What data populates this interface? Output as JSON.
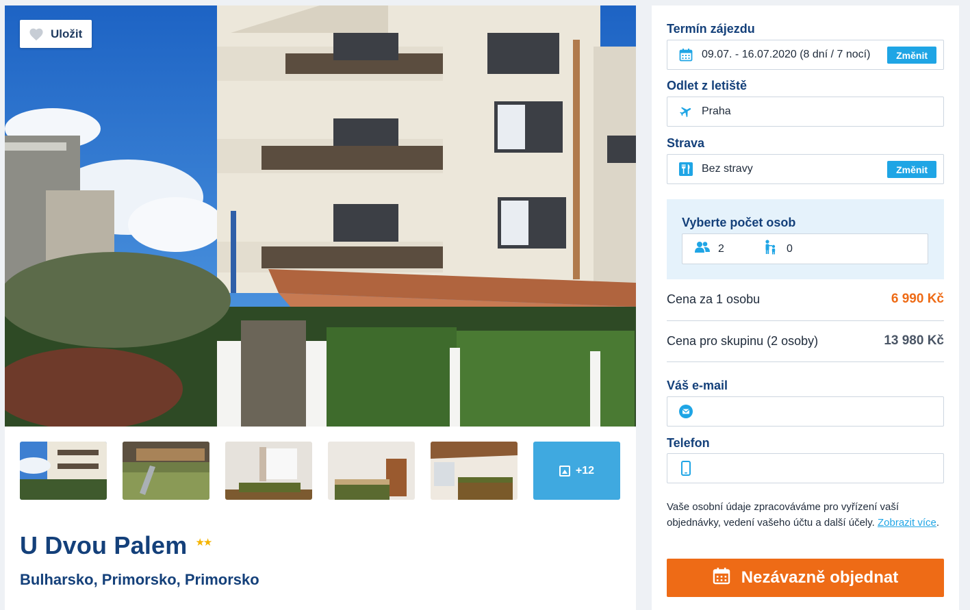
{
  "gallery": {
    "save_label": "Uložit",
    "more_count": "+12"
  },
  "hotel": {
    "name": "U Dvou Palem",
    "stars": "★★",
    "location": "Bulharsko, Primorsko, Primorsko"
  },
  "booking": {
    "term_label": "Termín zájezdu",
    "term_value": "09.07. - 16.07.2020 (8 dní / 7 nocí)",
    "change_label": "Změnit",
    "airport_label": "Odlet z letiště",
    "airport_value": "Praha",
    "board_label": "Strava",
    "board_value": "Bez stravy",
    "persons_label": "Vyberte počet osob",
    "adults": "2",
    "children": "0",
    "price_per_person_label": "Cena za 1 osobu",
    "price_per_person": "6 990 Kč",
    "price_group_label": "Cena pro skupinu (2 osoby)",
    "price_group": "13 980 Kč",
    "email_label": "Váš e-mail",
    "email_value": "",
    "phone_label": "Telefon",
    "phone_value": "",
    "privacy_text": "Vaše osobní údaje zpracováváme pro vyřízení vaší objednávky, vedení vašeho účtu a další účely.",
    "privacy_link": "Zobrazit více",
    "order_label": "Nezávazně objednat"
  },
  "colors": {
    "brand_blue": "#14407a",
    "accent_blue": "#1fa5e5",
    "accent_orange": "#ee6b16",
    "persons_bg": "#e5f2fb"
  },
  "icons": [
    "heart-icon",
    "calendar-icon",
    "plane-icon",
    "cutlery-icon",
    "adults-icon",
    "children-icon",
    "mail-icon",
    "phone-icon",
    "gallery-icon"
  ]
}
